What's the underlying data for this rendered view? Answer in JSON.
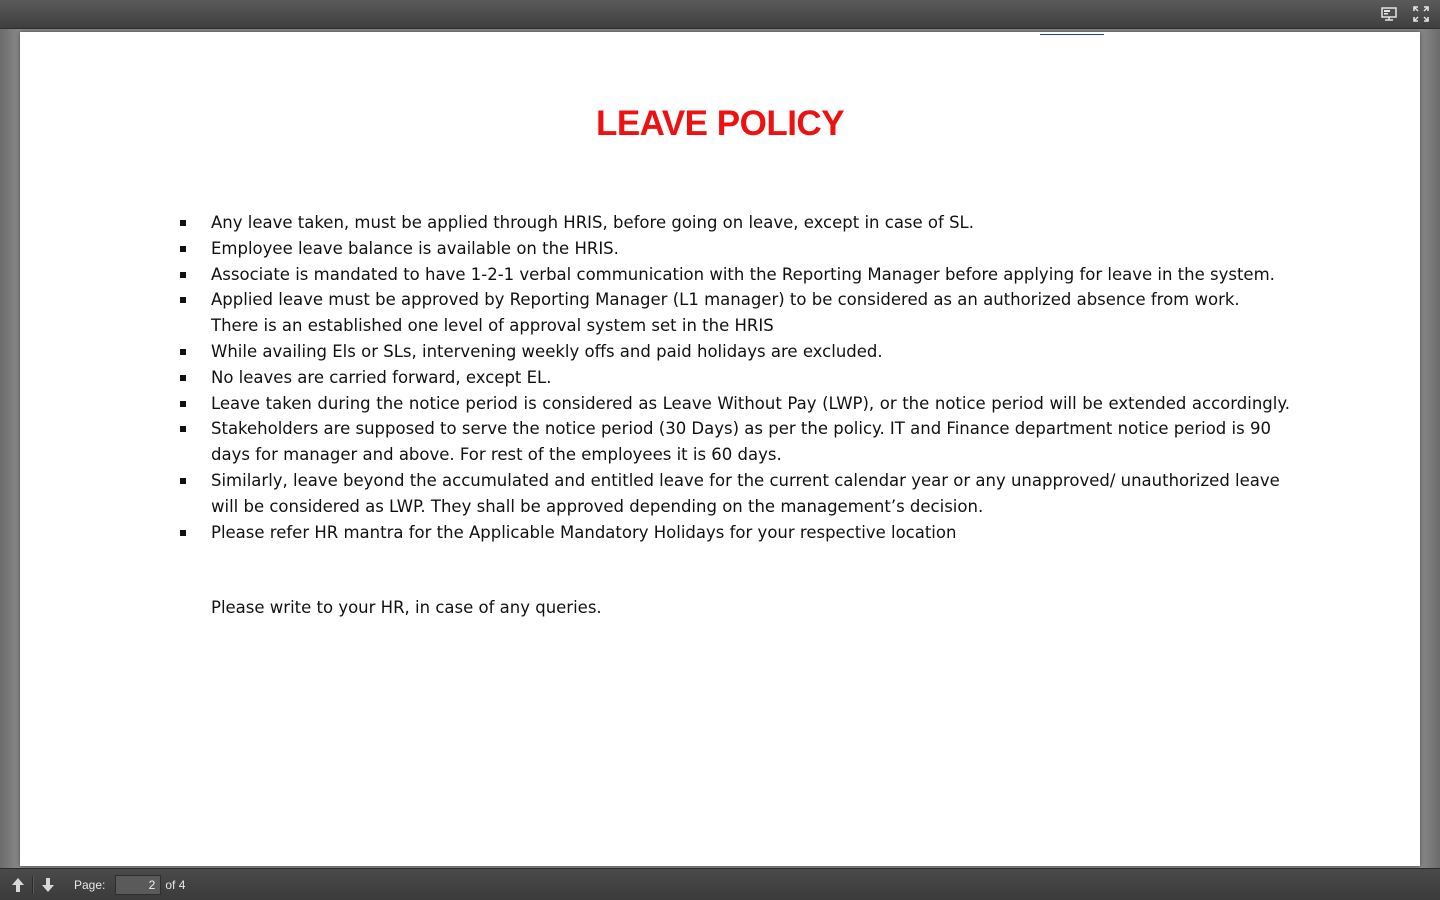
{
  "toolbar": {
    "icons": [
      "presentation-mode-icon",
      "fullscreen-icon"
    ]
  },
  "document": {
    "title": "LEAVE POLICY",
    "title_color": "#ee1111",
    "items": [
      {
        "text": "Any leave taken, must be applied through HRIS, before going on leave, except in case of SL."
      },
      {
        "text": "Employee leave balance is available on the HRIS."
      },
      {
        "text": "Associate is mandated to have 1-2-1 verbal communication with the Reporting Manager before applying for leave in the system."
      },
      {
        "text": "Applied leave must be approved by Reporting Manager (L1 manager) to be considered as an authorized absence from work. There is an established one level of approval system set in the HRIS"
      },
      {
        "text": "While availing Els or SLs, intervening weekly offs and paid holidays are excluded."
      },
      {
        "text": "No leaves are carried forward, except EL."
      },
      {
        "text": "Leave taken during the notice period is considered as Leave Without Pay (LWP), or the notice period will be extended accordingly."
      },
      {
        "text": "Stakeholders are supposed to serve the notice period (30 Days) as per the policy. IT and Finance department notice period is 90 days for manager and above. For rest of the employees it is 60 days."
      },
      {
        "text": "Similarly, leave beyond the accumulated and entitled leave for the current calendar year or any unapproved/ unauthorized leave will be considered as LWP. They shall be approved depending on the management’s decision."
      },
      {
        "text": "Please refer HR mantra for the Applicable Mandatory Holidays for your respective location"
      }
    ],
    "closing": "Please write to your HR, in case of any queries."
  },
  "pager": {
    "label": "Page:",
    "current": "2",
    "of": "of 4"
  }
}
